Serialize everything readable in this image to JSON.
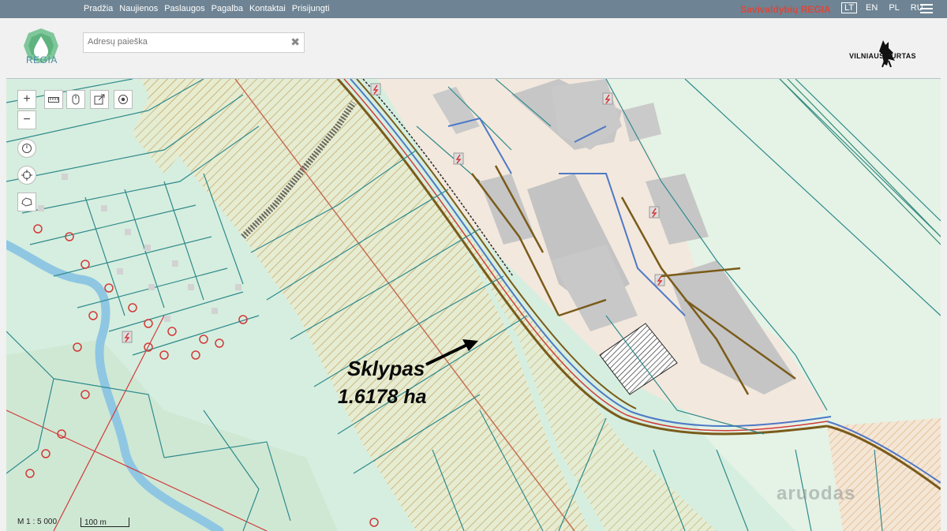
{
  "nav": {
    "items": [
      "Pradžia",
      "Naujienos",
      "Paslaugos",
      "Pagalba",
      "Kontaktai",
      "Prisijungti"
    ],
    "site_title": "Savivaldybių REGIA",
    "languages": [
      "LT",
      "EN",
      "PL",
      "RU"
    ],
    "active_language": "LT"
  },
  "header": {
    "logo_text": "REGIA",
    "search_placeholder": "Adresų paieška",
    "partner_logo_text": "VILNIAUS TURTAS"
  },
  "map": {
    "plot_label": "Sklypas",
    "plot_area": "1.6178 ha",
    "scale_text": "M 1 : 5 000",
    "scale_bar_label": "100 m",
    "watermark": "aruodas",
    "colors": {
      "base_green": "#d6eedf",
      "parcel_line": "#2f8a8c",
      "river": "#8fc7e3",
      "building": "#c5c5c5",
      "utility_red": "#d23a3a",
      "utility_brown": "#7a5b1a",
      "hatch": "#d9c48e"
    }
  }
}
